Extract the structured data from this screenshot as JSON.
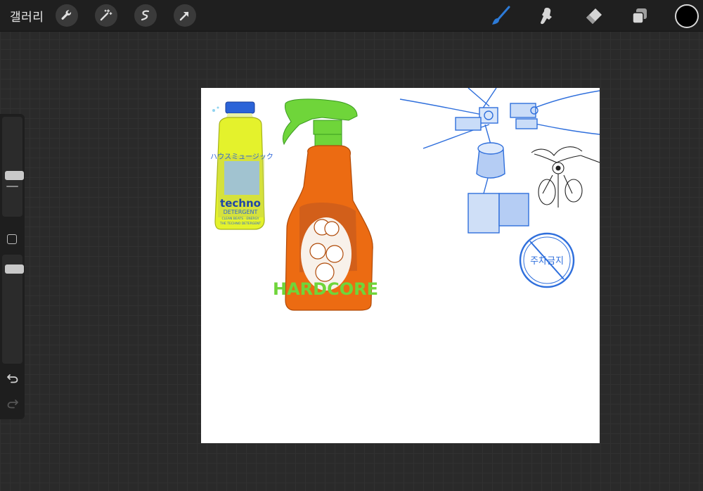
{
  "toolbar": {
    "gallery_label": "갤러리",
    "left_tools": [
      "wrench-icon",
      "magic-wand-icon",
      "selection-icon",
      "transform-arrow-icon"
    ],
    "right_tools": [
      "brush-icon",
      "smudge-icon",
      "eraser-icon",
      "layers-icon"
    ],
    "active_tool": "brush",
    "active_color": "#000000",
    "accent_color": "#2d7bd8"
  },
  "sidebar": {
    "brush_size": 0.4,
    "opacity": 0.88
  },
  "canvas": {
    "background": "#ffffff",
    "artwork": {
      "yellow_bottle": {
        "label_jp": "ハウスミュージック",
        "brand": "techno",
        "subtitle": "DETERGENT",
        "small_text_1": "CLEAN BEATS · ENERGY",
        "small_text_2": "THE TECHNO DETERGENT"
      },
      "orange_bottle": {
        "label": "HARDCORE"
      },
      "no_parking_sign": "주차금지"
    }
  }
}
